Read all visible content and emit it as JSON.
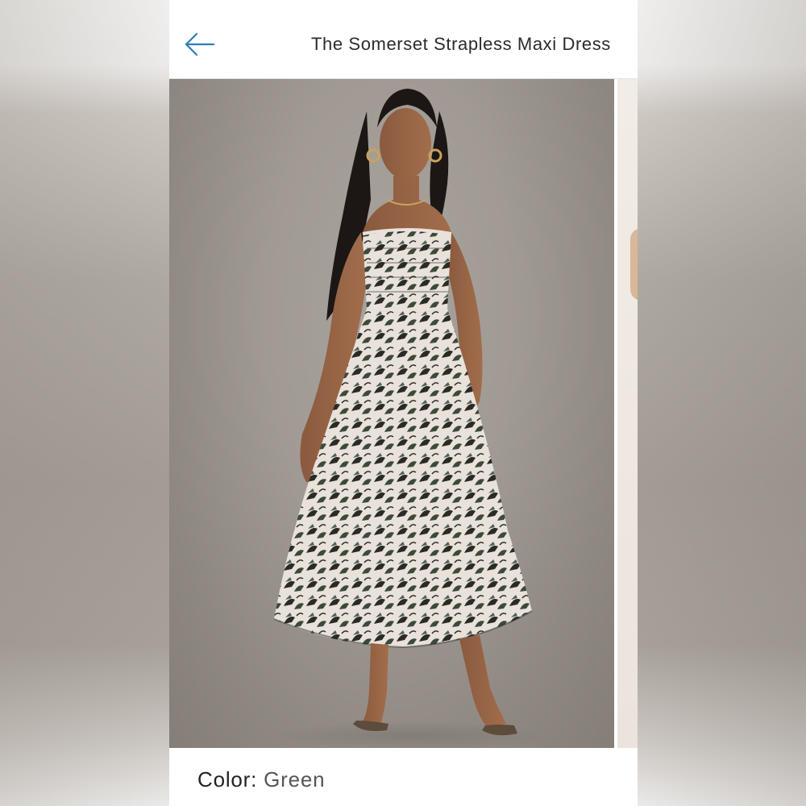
{
  "header": {
    "title": "The Somerset Strapless Maxi Dress",
    "back_icon": "arrow-left-icon"
  },
  "product": {
    "image_alt": "Model wearing The Somerset Strapless Maxi Dress in Green print",
    "color_label": "Color:",
    "color_value": "Green"
  },
  "colors": {
    "accent": "#2f7db4",
    "text": "#2b2b2b",
    "muted_text": "#555555",
    "background": "#ffffff"
  }
}
